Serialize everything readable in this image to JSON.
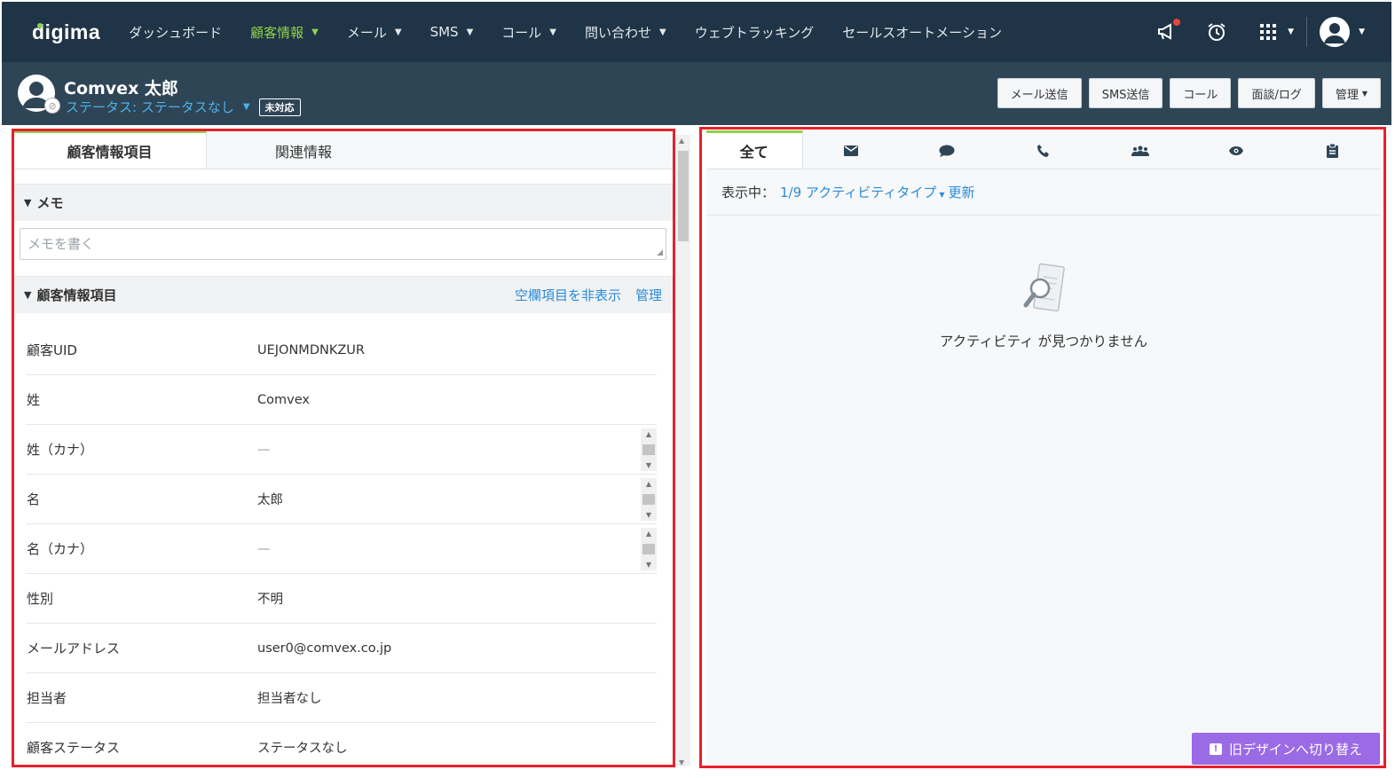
{
  "brand": {
    "logo_text": "digima"
  },
  "nav": {
    "items": [
      {
        "label": "ダッシュボード",
        "has_menu": false,
        "active": false
      },
      {
        "label": "顧客情報",
        "has_menu": true,
        "active": true
      },
      {
        "label": "メール",
        "has_menu": true,
        "active": false
      },
      {
        "label": "SMS",
        "has_menu": true,
        "active": false
      },
      {
        "label": "コール",
        "has_menu": true,
        "active": false
      },
      {
        "label": "問い合わせ",
        "has_menu": true,
        "active": false
      },
      {
        "label": "ウェブトラッキング",
        "has_menu": false,
        "active": false
      },
      {
        "label": "セールスオートメーション",
        "has_menu": false,
        "active": false
      }
    ],
    "right_icons": [
      "megaphone-icon",
      "alarm-clock-icon",
      "app-grid-icon",
      "user-avatar-icon"
    ]
  },
  "customer": {
    "name": "Comvex 太郎",
    "status": "ステータス: ステータスなし",
    "tag": "未対応"
  },
  "header_buttons": {
    "mail": "メール送信",
    "sms": "SMS送信",
    "call": "コール",
    "meeting": "面談/ログ",
    "manage": "管理"
  },
  "left_tabs": {
    "active": "顧客情報項目",
    "other": "関連情報"
  },
  "memo": {
    "title": "メモ",
    "placeholder": "メモを書く"
  },
  "fields_section": {
    "title": "顧客情報項目",
    "hide_empty": "空欄項目を非表示",
    "manage": "管理"
  },
  "fields": [
    {
      "label": "顧客UID",
      "value": "UEJONMDNKZUR"
    },
    {
      "label": "姓",
      "value": "Comvex"
    },
    {
      "label": "姓（カナ）",
      "value": "—"
    },
    {
      "label": "名",
      "value": "太郎"
    },
    {
      "label": "名（カナ）",
      "value": "—"
    },
    {
      "label": "性別",
      "value": "不明"
    },
    {
      "label": "メールアドレス",
      "value": "user0@comvex.co.jp"
    },
    {
      "label": "担当者",
      "value": "担当者なし"
    },
    {
      "label": "顧客ステータス",
      "value": "ステータスなし"
    }
  ],
  "activity": {
    "tab_all": "全て",
    "tab_icons": [
      "mail-icon",
      "chat-icon",
      "phone-icon",
      "group-icon",
      "eye-icon",
      "clipboard-icon"
    ],
    "showing_label": "表示中：",
    "filter_link": "1/9 アクティビティタイプ",
    "refresh_link": "更新",
    "empty_message": "アクティビティ が見つかりません"
  },
  "old_design_button": "旧デザインへ切り替え",
  "colors": {
    "nav_bg": "#1f3446",
    "accent_green": "#8fd14f",
    "link_blue": "#2b8bd6",
    "outline_red": "#e8202a",
    "purple": "#9b6be5"
  }
}
